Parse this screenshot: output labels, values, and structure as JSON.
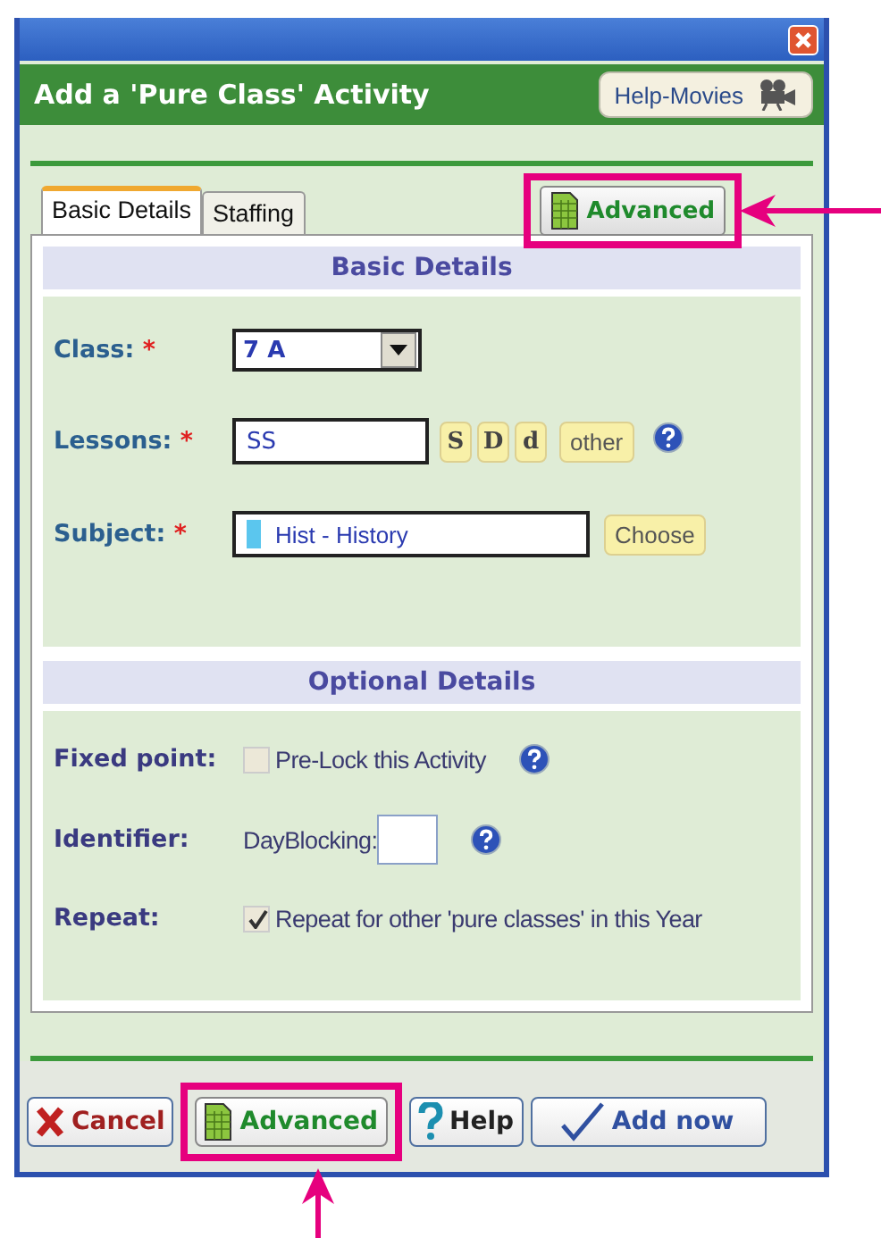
{
  "window": {
    "title": "Add a 'Pure Class' Activity",
    "help_button": "Help-Movies"
  },
  "tabs": [
    {
      "label": "Basic Details",
      "selected": true
    },
    {
      "label": "Staffing",
      "selected": false
    }
  ],
  "advanced_button": {
    "label": "Advanced",
    "highlighted": true
  },
  "basic_details": {
    "title": "Basic Details",
    "fields": [
      {
        "kind": "dropdown",
        "label": "Class:",
        "required_mark": "*",
        "value": "7 A"
      },
      {
        "kind": "lessons",
        "label": "Lessons:",
        "required_mark": "*",
        "value": "SS",
        "buttons": [
          "S",
          "D",
          "d",
          "other"
        ]
      },
      {
        "kind": "subject",
        "label": "Subject:",
        "required_mark": "*",
        "value": "Hist - History",
        "color": "#5bc6ee",
        "button": "Choose"
      }
    ]
  },
  "optional_details": {
    "title": "Optional Details",
    "rows": [
      {
        "kind": "checkbox",
        "label": "Fixed point:",
        "text": "Pre-Lock this Activity",
        "checked": false,
        "help": true
      },
      {
        "kind": "identifier",
        "label": "Identifier:",
        "text": "DayBlocking:",
        "help": true
      },
      {
        "kind": "checkbox",
        "label": "Repeat:",
        "text": "Repeat for other 'pure classes' in this Year",
        "checked": true,
        "help": false
      }
    ]
  },
  "footer_buttons": [
    {
      "kind": "cancel",
      "label": "Cancel",
      "highlighted": false
    },
    {
      "kind": "advanced",
      "label": "Advanced",
      "highlighted": true
    },
    {
      "kind": "help",
      "label": "Help",
      "highlighted": false
    },
    {
      "kind": "add",
      "label": "Add now",
      "highlighted": false
    }
  ]
}
